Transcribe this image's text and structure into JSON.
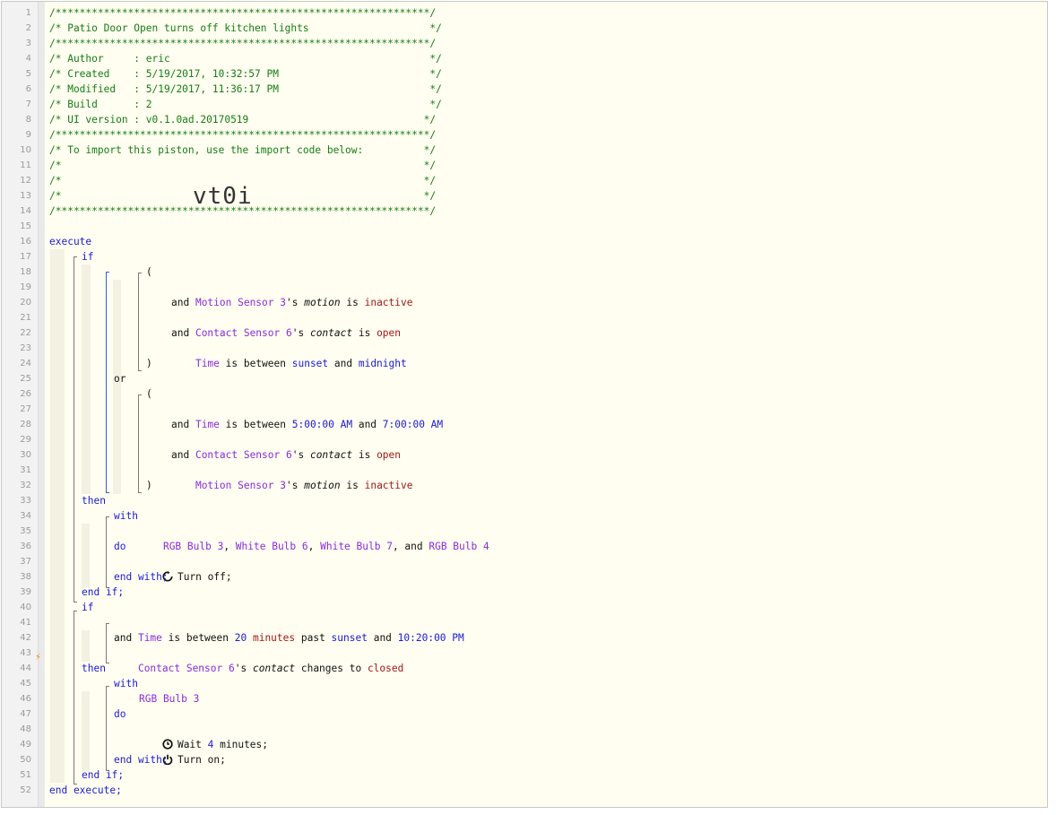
{
  "line_numbers": [
    "1",
    "2",
    "3",
    "4",
    "5",
    "6",
    "7",
    "8",
    "9",
    "10",
    "11",
    "12",
    "13",
    "14",
    "15",
    "16",
    "17",
    "18",
    "19",
    "20",
    "21",
    "22",
    "23",
    "24",
    "25",
    "26",
    "27",
    "28",
    "29",
    "30",
    "31",
    "32",
    "33",
    "34",
    "35",
    "36",
    "37",
    "38",
    "39",
    "40",
    "41",
    "42",
    "43",
    "44",
    "45",
    "46",
    "47",
    "48",
    "49",
    "50",
    "51",
    "52"
  ],
  "header": {
    "stars": "/**************************************************************/",
    "title": "/* Patio Door Open turns off kitchen lights                    */",
    "author": "/* Author     : eric                                           */",
    "created": "/* Created    : 5/19/2017, 10:32:57 PM                         */",
    "modified": "/* Modified   : 5/19/2017, 11:36:17 PM                         */",
    "build": "/* Build      : 2                                              */",
    "ui_version": "/* UI version : v0.1.0ad.20170519                             */",
    "import_note": "/* To import this piston, use the import code below:          */",
    "empty_line": "/*                                                            */",
    "import_code": "vt0i"
  },
  "kw": {
    "execute": "execute",
    "end_execute": "end execute;",
    "if": "if",
    "then": "then",
    "end_if": "end if;",
    "with": "with",
    "do": "do",
    "end_with": "end with;",
    "and": "and",
    "or": "or",
    "open_paren": "(",
    "close_paren": ")"
  },
  "conditions": {
    "motion_sensor_3": "Motion Sensor 3",
    "contact_sensor_6": "Contact Sensor 6",
    "possessive": "'s ",
    "motion": "motion",
    "contact": "contact",
    "is": " is ",
    "inactive": "inactive",
    "open": "open",
    "time": "Time",
    "is_between": " is between ",
    "and_word": " and ",
    "sunset": "sunset",
    "midnight": "midnight",
    "t_5am": "5:00:00 AM",
    "t_7am": "7:00:00 AM",
    "twenty": "20",
    "minutes": "minutes",
    "past": " past ",
    "t_1020pm": "10:20:00 PM",
    "changes_to": " changes to ",
    "closed": "closed"
  },
  "devices": {
    "rgb_bulb_3": "RGB Bulb 3",
    "white_bulb_6": "White Bulb 6",
    "white_bulb_7": "White Bulb 7",
    "rgb_bulb_4": "RGB Bulb 4",
    "comma": ", ",
    "comma_and": ", and "
  },
  "actions": {
    "turn_off": "Turn off;",
    "wait": "Wait ",
    "wait_value": "4",
    "wait_unit": " minutes;",
    "turn_on": "Turn on;"
  },
  "icons": {
    "turn_off": "refresh-icon",
    "wait": "clock-icon",
    "turn_on": "power-icon",
    "trigger": "lightning-bolt-icon"
  }
}
